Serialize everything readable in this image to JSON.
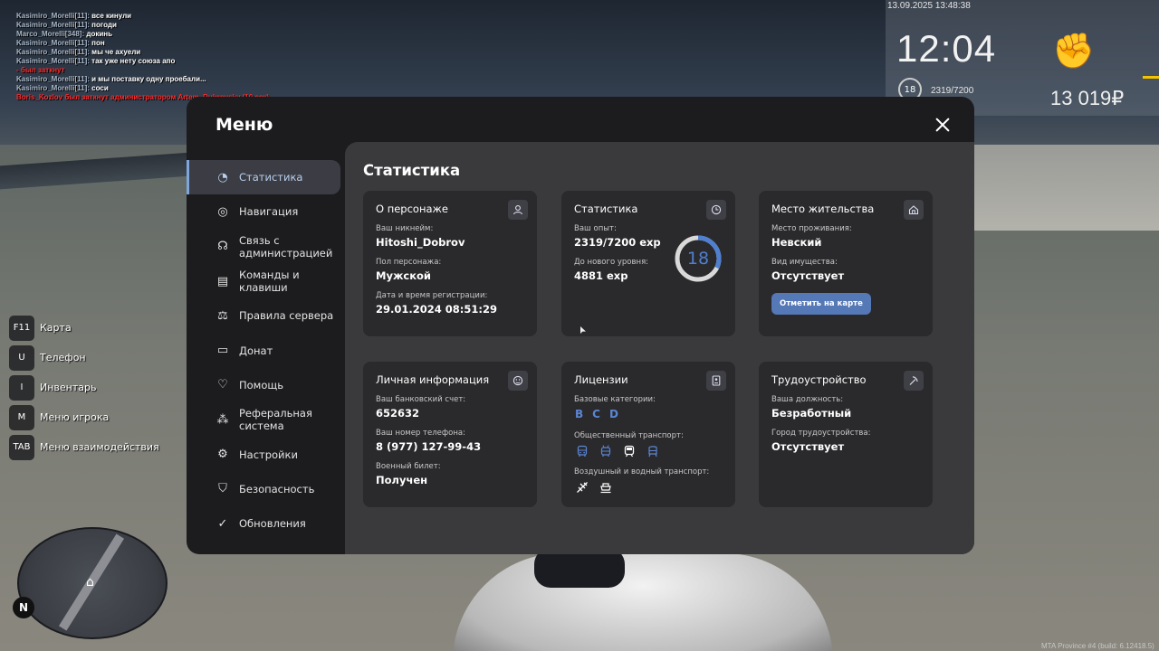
{
  "chat": [
    {
      "nick": "Kasimiro_Morelli[11]:",
      "text": " все кинули",
      "red": false
    },
    {
      "nick": "Kasimiro_Morelli[11]:",
      "text": " погоди",
      "red": false
    },
    {
      "nick": "Marco_Morelli[348]:",
      "text": " докинь",
      "red": false
    },
    {
      "nick": "Kasimiro_Morelli[11]:",
      "text": " пон",
      "red": false
    },
    {
      "nick": "Kasimiro_Morelli[11]:",
      "text": " мы че ахуели",
      "red": false
    },
    {
      "nick": "Kasimiro_Morelli[11]:",
      "text": " так уже нету союза апо",
      "red": false
    },
    {
      "nick": "",
      "text": " - был заткнут",
      "red": true
    },
    {
      "nick": "Kasimiro_Morelli[11]:",
      "text": " и мы поставку одну проебали...",
      "red": false
    },
    {
      "nick": "Kasimiro_Morelli[11]:",
      "text": " соси",
      "red": false
    },
    {
      "nick": "",
      "text": "Boris_Kozlov был заткнут администратором Artem_Dubrovsky (10 сек)",
      "red": true
    }
  ],
  "hud": {
    "datetime": "13.09.2025 13:48:38",
    "time": "12:04",
    "level": "18",
    "exp": "2319/7200",
    "money": "13 019₽"
  },
  "hotkeys": [
    {
      "key": "F11",
      "label": "Карта"
    },
    {
      "key": "U",
      "label": "Телефон"
    },
    {
      "key": "I",
      "label": "Инвентарь"
    },
    {
      "key": "M",
      "label": "Меню игрока"
    },
    {
      "key": "TAB",
      "label": "Меню взаимодействия"
    }
  ],
  "minimap": {
    "north": "N"
  },
  "build": "MTA Province #4 (build: 6.12418.5)",
  "menu": {
    "title": "Меню",
    "nav": [
      {
        "label": "Статистика",
        "icon": "pie-chart-icon",
        "glyph": "◔"
      },
      {
        "label": "Навигация",
        "icon": "compass-icon",
        "glyph": "◎"
      },
      {
        "label": "Связь с\nадминистрацией",
        "icon": "headset-icon",
        "glyph": "☊"
      },
      {
        "label": "Команды и\nклавиши",
        "icon": "document-icon",
        "glyph": "▤"
      },
      {
        "label": "Правила сервера",
        "icon": "scales-icon",
        "glyph": "⚖"
      },
      {
        "label": "Донат",
        "icon": "wallet-icon",
        "glyph": "▭"
      },
      {
        "label": "Помощь",
        "icon": "heart-hand-icon",
        "glyph": "♡"
      },
      {
        "label": "Реферальная\nсистема",
        "icon": "network-icon",
        "glyph": "⁂"
      },
      {
        "label": "Настройки",
        "icon": "gear-icon",
        "glyph": "⚙"
      },
      {
        "label": "Безопасность",
        "icon": "shield-icon",
        "glyph": "⛉"
      },
      {
        "label": "Обновления",
        "icon": "check-circle-icon",
        "glyph": "✓"
      }
    ],
    "active_index": 0
  },
  "stats": {
    "title": "Статистика",
    "character": {
      "title": "О персонаже",
      "nick_label": "Ваш никнейм:",
      "nick": "Hitoshi_Dobrov",
      "gender_label": "Пол персонажа:",
      "gender": "Мужской",
      "reg_label": "Дата и время регистрации:",
      "reg": "29.01.2024 08:51:29"
    },
    "statistics": {
      "title": "Статистика",
      "exp_label": "Ваш опыт:",
      "exp": "2319/7200 exp",
      "next_label": "До нового уровня:",
      "next": "4881 exp",
      "level": "18",
      "progress": 0.3221
    },
    "residence": {
      "title": "Место жительства",
      "place_label": "Место проживания:",
      "place": "Невский",
      "property_label": "Вид имущества:",
      "property": "Отсутствует",
      "button": "Отметить на карте"
    },
    "personal": {
      "title": "Личная информация",
      "bank_label": "Ваш банковский счет:",
      "bank": "652632",
      "phone_label": "Ваш номер телефона:",
      "phone": "8 (977) 127-99-43",
      "military_label": "Военный билет:",
      "military": "Получен"
    },
    "licenses": {
      "title": "Лицензии",
      "base_label": "Базовые категории:",
      "base": [
        "B",
        "C",
        "D"
      ],
      "public_label": "Общественный транспорт:",
      "air_label": "Воздушный и водный транспорт:"
    },
    "employment": {
      "title": "Трудоустройство",
      "position_label": "Ваша должность:",
      "position": "Безработный",
      "city_label": "Город трудоустройства:",
      "city": "Отсутствует"
    }
  }
}
